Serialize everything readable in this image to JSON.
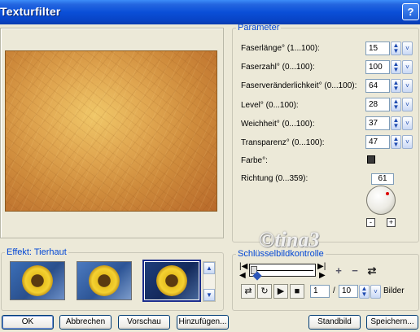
{
  "window": {
    "title": "Texturfilter",
    "help_button": "?"
  },
  "parameters": {
    "legend": "Parameter",
    "rows": [
      {
        "label": "Faserlänge° (1...100):",
        "value": "15"
      },
      {
        "label": "Faserzahl° (0...100):",
        "value": "100"
      },
      {
        "label": "Faserveränderlichkeit° (0...100):",
        "value": "64"
      },
      {
        "label": "Level° (0...100):",
        "value": "28"
      },
      {
        "label": "Weichheit° (0...100):",
        "value": "37"
      },
      {
        "label": "Transparenz° (0...100):",
        "value": "47"
      }
    ],
    "color_label": "Farbe°:",
    "color_value": "#3A3A3A",
    "direction_label": "Richtung (0...359):",
    "direction_value": "61",
    "minus": "-",
    "plus": "+"
  },
  "effect": {
    "legend": "Effekt: Tierhaut",
    "thumbnails": [
      "sunflower-texture-1",
      "sunflower-texture-2",
      "sunflower-texture-3-selected"
    ]
  },
  "keyframes": {
    "legend": "Schlüsselbildkontrolle",
    "current_frame": "1",
    "separator": "/",
    "total_frames": "10",
    "frames_label": "Bilder"
  },
  "watermark": "©tina3",
  "buttons": {
    "ok": "OK",
    "cancel": "Abbrechen",
    "preview": "Vorschau",
    "add": "Hinzufügen...",
    "default_image": "Standbild",
    "save": "Speichern..."
  }
}
